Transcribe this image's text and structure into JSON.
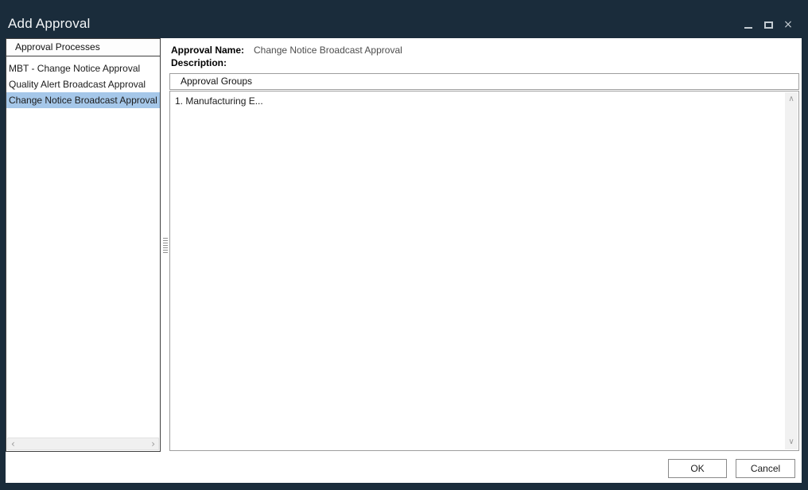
{
  "window": {
    "title": "Add Approval"
  },
  "icons": {
    "close": "×",
    "scroll_left": "‹",
    "scroll_right": "›",
    "scroll_up": "∧",
    "scroll_down": "∨"
  },
  "left_panel": {
    "header": "Approval Processes",
    "items": [
      {
        "label": "MBT - Change Notice Approval",
        "selected": false
      },
      {
        "label": "Quality Alert Broadcast Approval",
        "selected": false
      },
      {
        "label": "Change Notice Broadcast Approval",
        "selected": true
      }
    ]
  },
  "detail": {
    "approval_name_label": "Approval Name:",
    "approval_name_value": "Change Notice Broadcast Approval",
    "description_label": "Description:",
    "description_value": "",
    "groups_header": "Approval Groups",
    "groups": [
      {
        "label": "1. Manufacturing E..."
      }
    ]
  },
  "footer": {
    "ok_label": "OK",
    "cancel_label": "Cancel"
  },
  "colors": {
    "frame": "#1a2c3b",
    "selection": "#a5c7e9",
    "panel_border_dark": "#3f3f3f",
    "panel_border_light": "#9e9e9e",
    "scroll_track": "#f0f0f0",
    "value_text": "#4d4d4d"
  }
}
